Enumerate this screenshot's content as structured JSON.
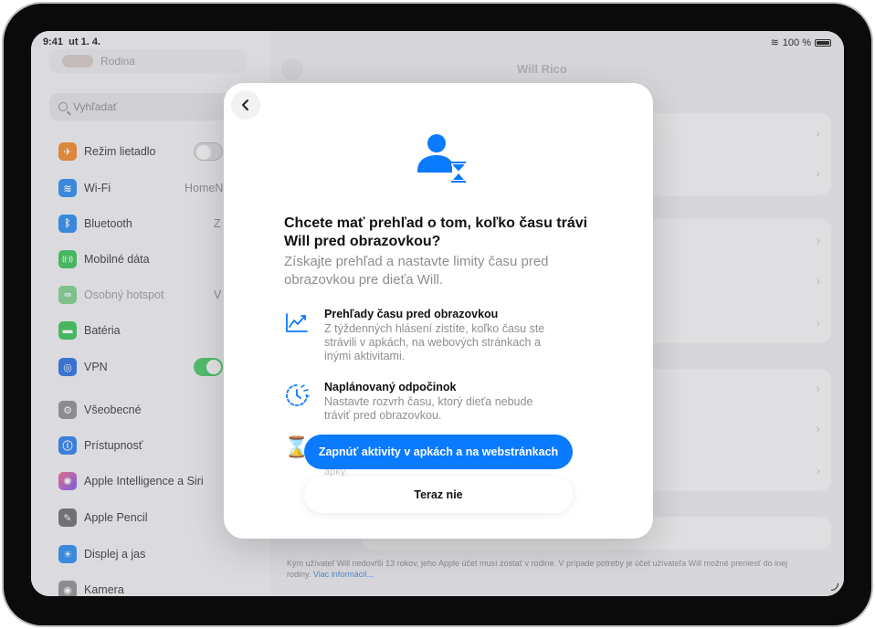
{
  "status": {
    "time": "9:41",
    "date": "ut 1. 4.",
    "battery": "100 %"
  },
  "sidebar": {
    "family_label": "Rodina",
    "search_placeholder": "Vyhľadať",
    "items": [
      {
        "label": "Režim lietadlo",
        "color": "#f08a2c",
        "glyph": "✈"
      },
      {
        "label": "Wi-Fi",
        "value": "HomeN",
        "color": "#2d8cf0",
        "glyph": "≋"
      },
      {
        "label": "Bluetooth",
        "value": "Z",
        "color": "#2d8cf0",
        "glyph": "ᛒ"
      },
      {
        "label": "Mobilné dáta",
        "color": "#3cc25a",
        "glyph": "((·))"
      },
      {
        "label": "Osobný hotspot",
        "value": "V",
        "color": "#7fcf8f",
        "glyph": "∞"
      },
      {
        "label": "Batéria",
        "color": "#3cc25a",
        "glyph": "▬"
      },
      {
        "label": "VPN",
        "color": "#2d6fe0",
        "glyph": "◎"
      },
      {
        "label": "Všeobecné",
        "color": "#8e8e93",
        "glyph": "⚙"
      },
      {
        "label": "Prístupnosť",
        "color": "#2d7ff0",
        "glyph": "ⓘ"
      },
      {
        "label": "Apple Intelligence a Siri",
        "color": "#b44fd6",
        "glyph": "✺"
      },
      {
        "label": "Apple Pencil",
        "color": "#6d6d72",
        "glyph": "✎"
      },
      {
        "label": "Displej a jas",
        "color": "#2d8cf0",
        "glyph": "☀"
      },
      {
        "label": "Kamera",
        "color": "#8e8e93",
        "glyph": "◉"
      }
    ]
  },
  "detail": {
    "title": "Will Rico",
    "footnote": "Kým užívateľ Will nedovŕši 13 rokov, jeho Apple účet musí zostať v rodine. V prípade potreby je účet užívateľa Will možné preniesť do inej rodiny.",
    "footnote_link": "Viac informácií..."
  },
  "modal": {
    "title": "Chcete mať prehľad o tom, koľko času trávi Will pred obrazovkou?",
    "subtitle": "Získajte prehľad a nastavte limity času pred obrazovkou pre dieťa Will.",
    "features": [
      {
        "title": "Prehľady času pred obrazovkou",
        "desc": "Z týždenných hlásení zistíte, koľko času ste strávili v apkách, na webových stránkach a inými aktivitami."
      },
      {
        "title": "Naplánovaný odpočinok",
        "desc": "Nastavte rozvrh času, ktorý dieťa nebude tráviť pred obrazovkou."
      }
    ],
    "ghost_text": "apky.",
    "primary_button": "Zapnúť aktivity v apkách a na webstránkach",
    "secondary_button": "Teraz nie"
  },
  "colors": {
    "accent": "#0a7aff",
    "toggle_on": "#49c768"
  }
}
